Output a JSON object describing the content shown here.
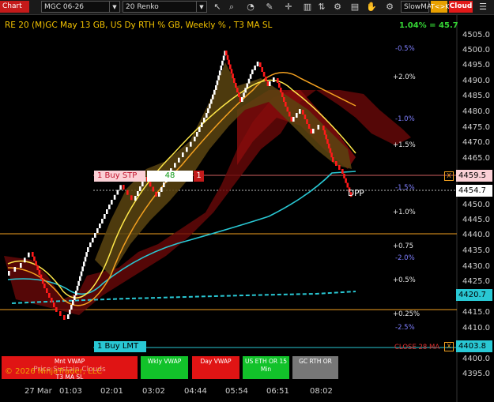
{
  "toolbar": {
    "chart_label": "Chart",
    "instrument": "MGC 06-26",
    "period": "20 Renko",
    "slow_ma": "SlowMA",
    "tk_label": "T<>K",
    "cloud_label": "Cloud",
    "icons": [
      "cursor-icon",
      "zoom-icon",
      "chart-properties-icon",
      "draw-icon",
      "chart-type-icon",
      "indicators-icon",
      "strategies-icon",
      "templates-icon",
      "crosshair-icon",
      "hand-icon",
      "text-icon",
      "settings-icon"
    ]
  },
  "chart": {
    "title": "RE 20  (M)GC May 13 GB, US Dy RTH % GB, Weekly % , T3 MA SL",
    "pct_change": "1.04% = 45.7",
    "price_ticks": [
      "4505.0",
      "4500.0",
      "4495.0",
      "4490.0",
      "4485.0",
      "4480.0",
      "4475.0",
      "4470.0",
      "4465.0",
      "4450.0",
      "4445.0",
      "4440.0",
      "4435.0",
      "4430.0",
      "4425.0",
      "4415.0",
      "4410.0",
      "4400.0",
      "4395.0"
    ],
    "time_ticks": [
      "27 Mar",
      "01:03",
      "02:01",
      "03:02",
      "04:44",
      "05:54",
      "06:51",
      "08:02"
    ],
    "pct_labels": [
      {
        "text": "-0.5%",
        "color": "#7f7fff"
      },
      {
        "text": "+2.0%",
        "color": "#e6e6e6"
      },
      {
        "text": "-1.0%",
        "color": "#7f7fff"
      },
      {
        "text": "+1.5%",
        "color": "#e6e6e6"
      },
      {
        "text": "-1.5%",
        "color": "#7f7fff"
      },
      {
        "text": "+1.0%",
        "color": "#e6e6e6"
      },
      {
        "text": "+0.75",
        "color": "#e6e6e6"
      },
      {
        "text": "-2.0%",
        "color": "#7f7fff"
      },
      {
        "text": "+0.5%",
        "color": "#e6e6e6"
      },
      {
        "text": "+0.25%",
        "color": "#e6e6e6"
      },
      {
        "text": "-2.5%",
        "color": "#7f7fff"
      }
    ],
    "price_flags": [
      {
        "text": "4459.5",
        "bg": "#fbd0d6"
      },
      {
        "text": "4454.7",
        "bg": "#ffffff"
      },
      {
        "text": "4420.7",
        "bg": "#29c8d4"
      },
      {
        "text": "4403.8",
        "bg": "#29c8d4"
      }
    ],
    "orders": {
      "buy_stp_label": "1 Buy STP",
      "buy_stp_qty": "48",
      "buy_stp_close": "1",
      "buy_lmt_label": "1 Buy LMT"
    },
    "dpp_label": "DPP",
    "close_label": "CLOSE 28 MA",
    "x_marker": "X"
  },
  "buttons": {
    "mnt_vwap": "Mnt VWAP",
    "price_cloud": "Price Sustain Clouds",
    "t3_ma_sl": "T3 MA SL",
    "wkly_vwap": "Wkly VWAP",
    "day_vwap": "Day VWAP",
    "us_eth": "US ETH OR 15 Min",
    "gc_rth": "GC RTH OR"
  },
  "copyright": "© 2026 NinjaTrader, LLC",
  "colors": {
    "chart_accent": "#c41a1a",
    "bull_candle": "#ffffff",
    "bear_candle": "#ff1a1a",
    "cyan_line": "#29c8d4",
    "orange_line": "#f2a020",
    "yellow_line": "#ffe84a"
  }
}
